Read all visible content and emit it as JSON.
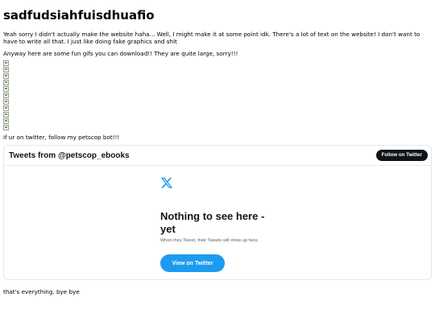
{
  "page": {
    "title": "sadfudsiahfuisdhuafio",
    "intro": "Yeah sorry I didn't actually make the website haha... Well, I might make it at some point idk. There's a lot of text on the website! I don't want to have to write all that. I just like doing fake graphics and shit",
    "gifs_text": "Anyway here are some fun gifs you can download!! They are quite large, sorry!!!",
    "gif_count": 11,
    "follow_text": "if ur on twitter, follow my petscop bot!!!",
    "closing": "that's everything. bye bye"
  },
  "timeline": {
    "header": "Tweets from @petscop_ebooks",
    "follow_button": "Follow on Twitter",
    "empty_title": "Nothing to see here - yet",
    "empty_subtitle": "When they Tweet, their Tweets will show up here.",
    "view_button": "View on Twitter",
    "accent": "#1d9bf0",
    "logo_icon": "x-logo-icon"
  }
}
